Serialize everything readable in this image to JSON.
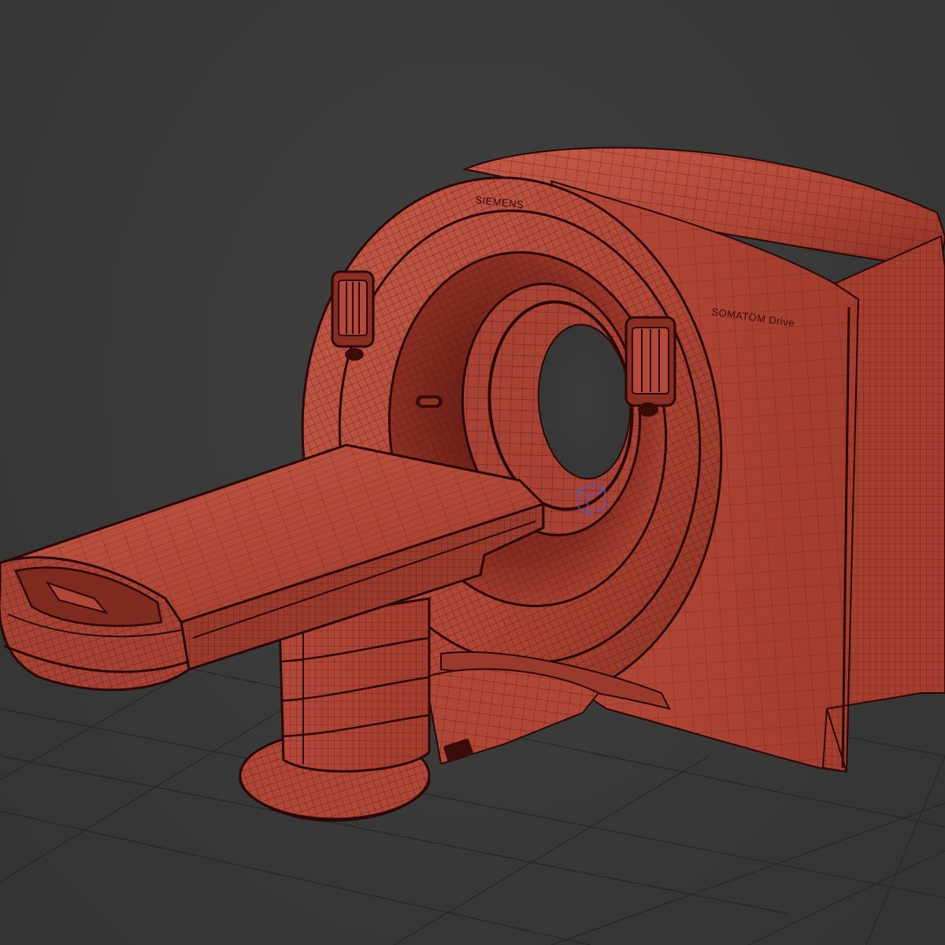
{
  "viewport": {
    "background_color": "#3a3a3a",
    "grid_color": "#262626",
    "model_color": "#b84a3a",
    "wire_color": "#3a0c08"
  },
  "model": {
    "brand_label": "SIEMENS",
    "model_label": "SOMATOM Drive",
    "gizmo_icon": "transform-gizmo-icon"
  }
}
